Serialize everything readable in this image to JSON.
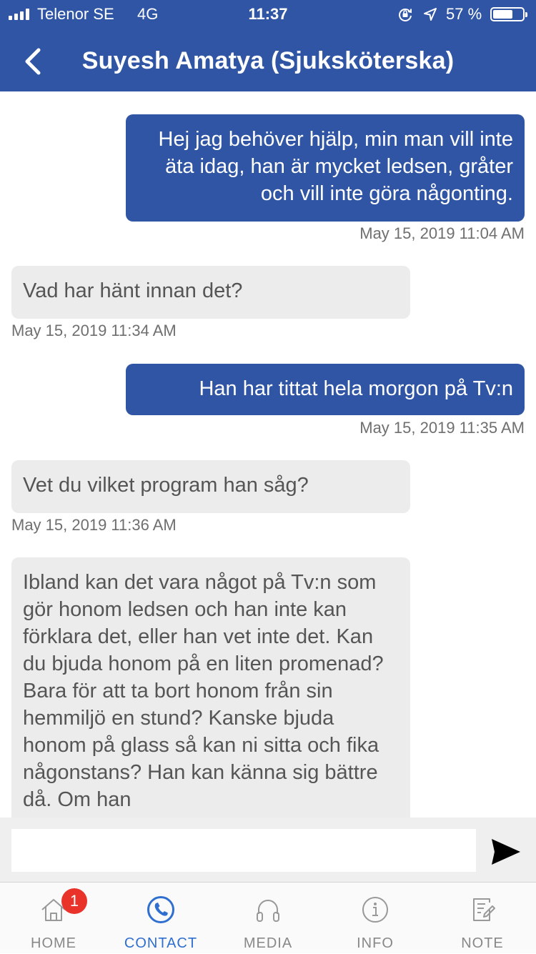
{
  "status_bar": {
    "carrier": "Telenor SE",
    "network": "4G",
    "time": "11:37",
    "battery_percent": "57 %",
    "battery_level": 0.57
  },
  "header": {
    "title": "Suyesh Amatya (Sjuksköterska)",
    "background": "#2f55a4"
  },
  "messages": [
    {
      "direction": "outgoing",
      "text": "Hej jag behöver hjälp, min man vill inte äta idag, han är mycket ledsen, gråter och vill inte göra någonting.",
      "time": "May 15, 2019 11:04 AM"
    },
    {
      "direction": "incoming",
      "text": "Vad har hänt innan det?",
      "time": "May 15, 2019 11:34 AM"
    },
    {
      "direction": "outgoing",
      "text": "Han har tittat hela morgon på Tv:n",
      "time": "May 15, 2019 11:35 AM"
    },
    {
      "direction": "incoming",
      "text": "Vet du vilket program han såg?",
      "time": "May 15, 2019 11:36 AM"
    },
    {
      "direction": "incoming",
      "text": "Ibland kan det vara något på Tv:n som gör honom ledsen och han inte kan förklara det, eller han vet inte det. Kan du bjuda honom på en liten promenad? Bara för att ta bort honom från sin hemmiljö en stund? Kanske bjuda honom på glass så kan ni sitta och fika någonstans? Han kan känna sig bättre då. Om han",
      "time": ""
    }
  ],
  "composer": {
    "placeholder": "",
    "value": ""
  },
  "tabs": [
    {
      "label": "HOME",
      "icon": "home-icon",
      "badge": "1"
    },
    {
      "label": "CONTACT",
      "icon": "phone-icon",
      "active": true
    },
    {
      "label": "MEDIA",
      "icon": "headphones-icon"
    },
    {
      "label": "INFO",
      "icon": "info-icon"
    },
    {
      "label": "NOTE",
      "icon": "note-icon"
    }
  ],
  "colors": {
    "accent": "#2f55a4",
    "active_tab": "#2f6fd0",
    "badge": "#e8322a",
    "incoming_bubble": "#ececec"
  }
}
